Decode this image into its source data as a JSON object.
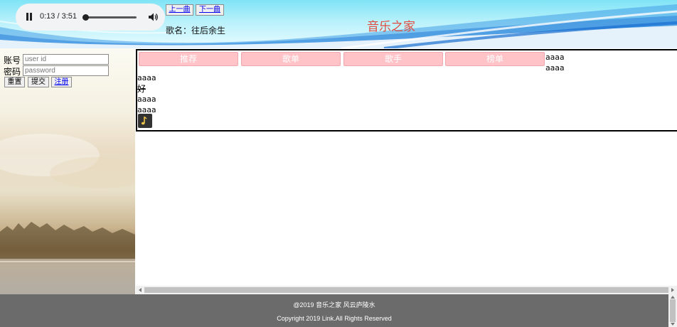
{
  "player": {
    "time_text": "0:13 / 3:51",
    "progress": 0.056,
    "pause_icon": "pause-icon",
    "volume_icon": "volume-icon"
  },
  "controls": {
    "prev_label": "上一曲",
    "next_label": "下一曲"
  },
  "song": {
    "label": "歌名：往后余生"
  },
  "site": {
    "title": "音乐之家"
  },
  "login": {
    "account_label": "账号",
    "account_placeholder": "user id",
    "password_label": "密码",
    "password_placeholder": "password",
    "reset_label": "重置",
    "submit_label": "提交",
    "register_label": "注册"
  },
  "content": {
    "tabs": [
      "推荐",
      "歌单",
      "歌手",
      "榜单"
    ],
    "side_texts": [
      "aaaa",
      "aaaa"
    ],
    "body_texts": [
      "aaaa",
      "aaaa",
      "aaaa"
    ],
    "strike_char": "好",
    "music_icon": "music-note-icon"
  },
  "footer": {
    "line1": "@2019 音乐之家 风云庐陵水",
    "line2": "Copyright 2019 Link.All Rights Reserved"
  },
  "colors": {
    "title": "#e04c3f",
    "tab_bg": "#ffc3c8",
    "footer_bg": "#6b6b6b",
    "header_bg": "#7fe4f6"
  }
}
